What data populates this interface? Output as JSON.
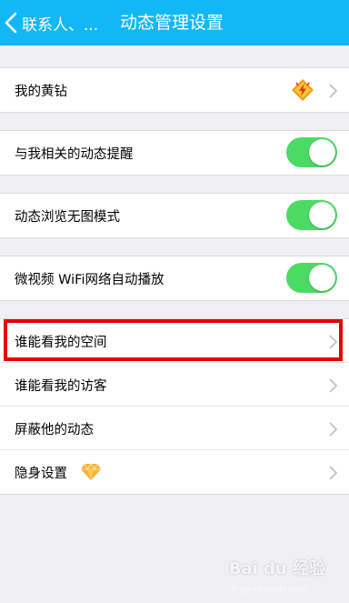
{
  "header": {
    "back_label": "联系人、...",
    "title": "动态管理设置"
  },
  "groups": {
    "g1": {
      "row1": {
        "label": "我的黄钻",
        "badge_icon": "yellow-diamond-vip-icon"
      }
    },
    "g2": {
      "row1": {
        "label": "与我相关的动态提醒",
        "toggle_on": true
      }
    },
    "g3": {
      "row1": {
        "label": "动态浏览无图模式",
        "toggle_on": true
      }
    },
    "g4": {
      "row1": {
        "label": "微视频 WiFi网络自动播放",
        "toggle_on": true
      }
    },
    "g5": {
      "row1": {
        "label": "谁能看我的空间"
      },
      "row2": {
        "label": "谁能看我的访客"
      },
      "row3": {
        "label": "屏蔽他的动态"
      },
      "row4": {
        "label": "隐身设置",
        "badge_icon": "diamond-icon"
      }
    }
  },
  "colors": {
    "header_bg": "#12b7f5",
    "toggle_on": "#4cd964",
    "highlight": "#e60000"
  },
  "watermark": {
    "text": "Bai du 经验",
    "sub": "jingyan.baidu.com"
  }
}
